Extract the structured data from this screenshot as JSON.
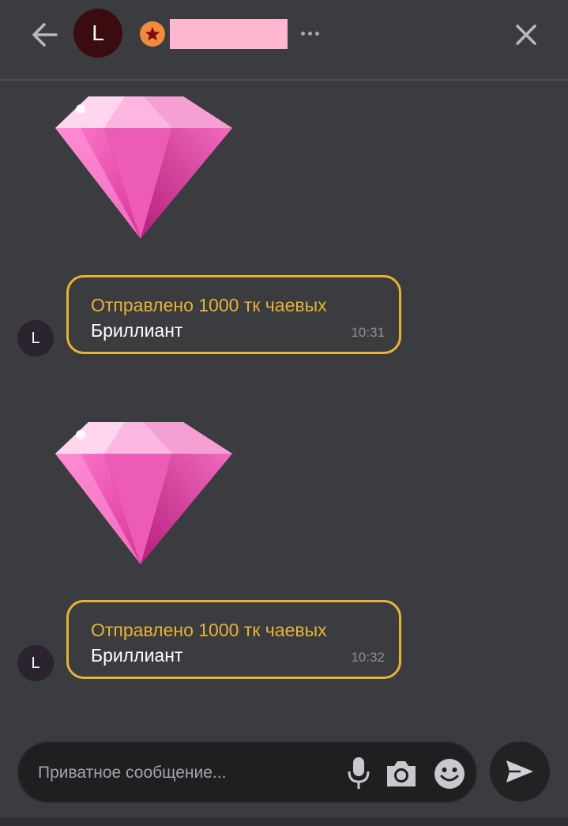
{
  "header": {
    "avatar_letter": "L"
  },
  "messages": [
    {
      "tip_text": "Отправлено 1000 тк чаевых",
      "gift_name": "Бриллиант",
      "time": "10:31",
      "avatar_letter": "L"
    },
    {
      "tip_text": "Отправлено 1000 тк чаевых",
      "gift_name": "Бриллиант",
      "time": "10:32",
      "avatar_letter": "L"
    }
  ],
  "composer": {
    "placeholder": "Приватное сообщение..."
  },
  "colors": {
    "background": "#3b3c40",
    "accent_gold": "#e8b332",
    "gem_pink": "#f06bbd",
    "redaction_pink": "#ffb6cf",
    "badge_orange": "#f08a3c"
  },
  "icons": [
    "back-arrow-icon",
    "star-icon",
    "more-icon",
    "close-icon",
    "diamond-gift-icon",
    "mic-icon",
    "camera-icon",
    "emoji-icon",
    "send-icon"
  ]
}
